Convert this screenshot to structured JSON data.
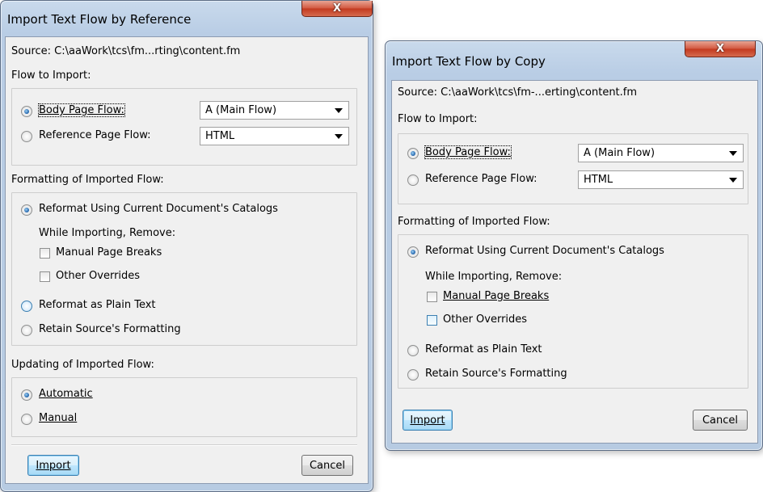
{
  "dialog_ref": {
    "title": "Import Text Flow by Reference",
    "close_label": "X",
    "source": "Source: C:\\aaWork\\tcs\\fm...rting\\content.fm",
    "flow_to_import_label": "Flow to Import:",
    "body_page_flow_label": "Body Page Flow:",
    "body_page_flow_value": "A (Main Flow)",
    "reference_page_flow_label": "Reference Page Flow:",
    "reference_page_flow_value": "HTML",
    "formatting_label": "Formatting of Imported Flow:",
    "reformat_catalogs_label": "Reformat Using Current Document's Catalogs",
    "while_importing_label": "While Importing, Remove:",
    "manual_page_breaks_label": "Manual Page Breaks",
    "other_overrides_label": "Other Overrides",
    "reformat_plain_text_label": "Reformat as Plain Text",
    "retain_formatting_label": "Retain Source's Formatting",
    "updating_label": "Updating of Imported Flow:",
    "automatic_label": "Automatic",
    "manual_label": "Manual",
    "import_label": "Import",
    "cancel_label": "Cancel"
  },
  "dialog_copy": {
    "title": "Import Text Flow by Copy",
    "close_label": "X",
    "source": "Source: C:\\aaWork\\tcs\\fm-...erting\\content.fm",
    "flow_to_import_label": "Flow to Import:",
    "body_page_flow_label": "Body Page Flow:",
    "body_page_flow_value": "A (Main Flow)",
    "reference_page_flow_label": "Reference Page Flow:",
    "reference_page_flow_value": "HTML",
    "formatting_label": "Formatting of Imported Flow:",
    "reformat_catalogs_label": "Reformat Using Current Document's Catalogs",
    "while_importing_label": "While Importing, Remove:",
    "manual_page_breaks_label": "Manual Page Breaks",
    "other_overrides_label": "Other Overrides",
    "reformat_plain_text_label": "Reformat as Plain Text",
    "retain_formatting_label": "Retain Source's Formatting",
    "import_label": "Import",
    "cancel_label": "Cancel"
  }
}
